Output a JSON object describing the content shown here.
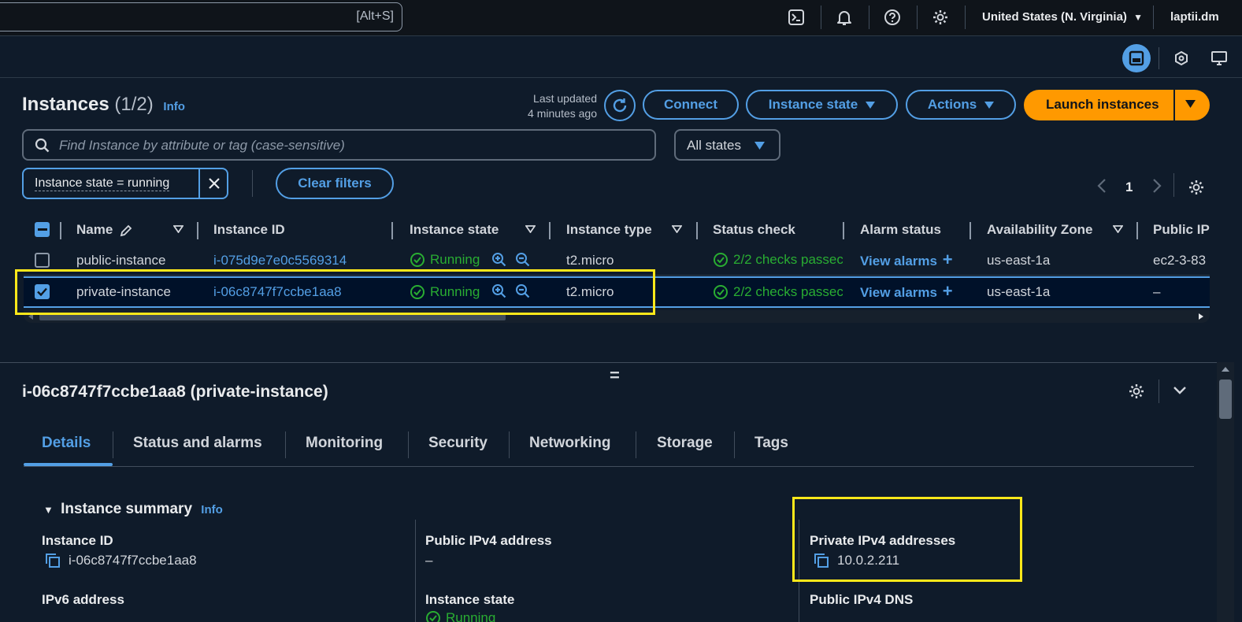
{
  "topnav": {
    "search_shortcut": "[Alt+S]",
    "region": "United States (N. Virginia)",
    "user": "laptii.dm"
  },
  "instances": {
    "title": "Instances",
    "count": "(1/2)",
    "info": "Info",
    "last_updated_line1": "Last updated",
    "last_updated_line2": "4 minutes ago",
    "buttons": {
      "connect": "Connect",
      "instance_state": "Instance state",
      "actions": "Actions",
      "launch": "Launch instances"
    },
    "search_placeholder": "Find Instance by attribute or tag (case-sensitive)",
    "states_select": "All states",
    "filter_token": "Instance state = running",
    "clear_filters": "Clear filters",
    "page": "1"
  },
  "table": {
    "headers": {
      "name": "Name",
      "instance_id": "Instance ID",
      "instance_state": "Instance state",
      "instance_type": "Instance type",
      "status_check": "Status check",
      "alarm_status": "Alarm status",
      "availability_zone": "Availability Zone",
      "public_ip": "Public IP"
    },
    "rows": [
      {
        "name": "public-instance",
        "instance_id": "i-075d9e7e0c5569314",
        "state": "Running",
        "type": "t2.micro",
        "status": "2/2 checks passec",
        "alarm": "View alarms",
        "az": "us-east-1a",
        "public_ip": "ec2-3-83",
        "selected": false
      },
      {
        "name": "private-instance",
        "instance_id": "i-06c8747f7ccbe1aa8",
        "state": "Running",
        "type": "t2.micro",
        "status": "2/2 checks passec",
        "alarm": "View alarms",
        "az": "us-east-1a",
        "public_ip": "–",
        "selected": true
      }
    ]
  },
  "details": {
    "title": "i-06c8747f7ccbe1aa8 (private-instance)",
    "tabs": [
      "Details",
      "Status and alarms",
      "Monitoring",
      "Security",
      "Networking",
      "Storage",
      "Tags"
    ],
    "summary_heading": "Instance summary",
    "summary_info": "Info",
    "fields": {
      "instance_id_label": "Instance ID",
      "instance_id_value": "i-06c8747f7ccbe1aa8",
      "public_ipv4_label": "Public IPv4 address",
      "public_ipv4_value": "–",
      "private_ipv4_label": "Private IPv4 addresses",
      "private_ipv4_value": "10.0.2.211",
      "ipv6_label": "IPv6 address",
      "instance_state_label": "Instance state",
      "instance_state_value": "Running",
      "public_dns_label": "Public IPv4 DNS"
    }
  },
  "colors": {
    "accent": "#539fe5",
    "launch": "#ff9900",
    "running": "#29ad32",
    "highlight": "#ffe81a",
    "background": "#0f1b2a"
  }
}
